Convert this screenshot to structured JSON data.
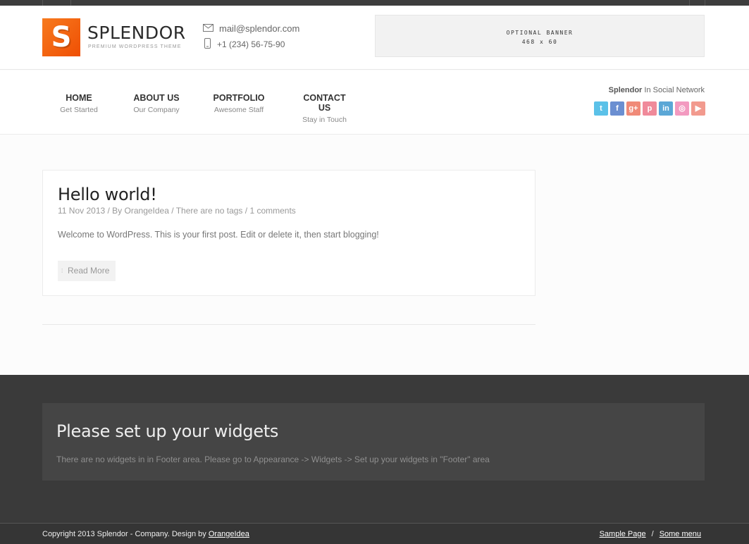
{
  "brand": {
    "logo_letter": "S",
    "name": "SPLENDOR",
    "tagline": "PREMIUM WORDPRESS THEME"
  },
  "contact": {
    "email": "mail@splendor.com",
    "phone": "+1 (234) 56-75-90"
  },
  "banner": {
    "line1": "OPTIONAL BANNER",
    "line2": "468 x 60"
  },
  "nav": [
    {
      "title": "HOME",
      "subtitle": "Get Started"
    },
    {
      "title": "ABOUT US",
      "subtitle": "Our Company"
    },
    {
      "title": "PORTFOLIO",
      "subtitle": "Awesome Staff"
    },
    {
      "title": "CONTACT US",
      "subtitle": "Stay in Touch"
    }
  ],
  "social": {
    "brand": "Splendor",
    "rest": " In Social Network",
    "icons": [
      {
        "name": "twitter-icon",
        "glyph": "t",
        "color": "#5bc1e8"
      },
      {
        "name": "facebook-icon",
        "glyph": "f",
        "color": "#6b8fd1"
      },
      {
        "name": "google-plus-icon",
        "glyph": "g+",
        "color": "#f08a78"
      },
      {
        "name": "pinterest-icon",
        "glyph": "p",
        "color": "#f08a9a"
      },
      {
        "name": "linkedin-icon",
        "glyph": "in",
        "color": "#5ba7d6"
      },
      {
        "name": "dribbble-icon",
        "glyph": "◎",
        "color": "#f39ac0"
      },
      {
        "name": "youtube-icon",
        "glyph": "▶",
        "color": "#f29a8e"
      }
    ]
  },
  "post": {
    "title": "Hello world!",
    "date": "11 Nov 2013",
    "by": " / By ",
    "author": "OrangeIdea",
    "sep1": " / ",
    "tags": "There are no tags",
    "sep2": " / ",
    "comments": "1 comments",
    "excerpt": "Welcome to WordPress. This is your first post. Edit or delete it, then start blogging!",
    "read_more": "Read More"
  },
  "footer": {
    "widget_title": "Please set up your widgets",
    "widget_text": "There are no widgets in in Footer area. Please go to Appearance -> Widgets -> Set up your widgets in \"Footer\" area",
    "copyright": "Copyright 2013 Splendor - Company. Design by ",
    "designer": "OrangeIdea",
    "links": [
      "Sample Page",
      "Some menu"
    ],
    "link_separator": "/"
  },
  "colors": {
    "accent": "#f25c0a",
    "footer_bg": "#3a3a3a"
  }
}
